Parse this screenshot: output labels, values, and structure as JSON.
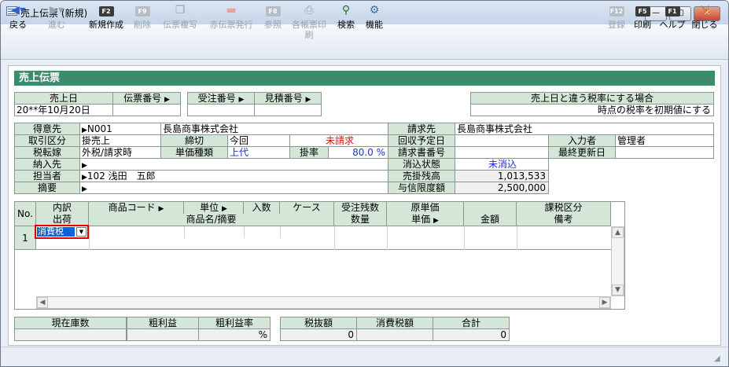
{
  "window": {
    "title": "売上伝票 (新規)",
    "controls": {
      "minimize": "—",
      "maximize": "□",
      "close": "✕"
    }
  },
  "toolbar": {
    "back": "戻る",
    "forward": "進む",
    "new": "新規作成",
    "delete": "削除",
    "copy": "伝票複写",
    "red_slip": "赤伝票発行",
    "reference": "参照",
    "print_multi": "各帳票印刷",
    "search": "検索",
    "function": "機能",
    "register": "登録",
    "print": "印刷",
    "help": "ヘルプ",
    "close": "閉じる",
    "keys": {
      "new": "F2",
      "delete": "F9",
      "reference": "F8",
      "register": "F12",
      "print": "F5",
      "help": "F1"
    }
  },
  "header": {
    "title": "売上伝票"
  },
  "slip": {
    "sales_date_label": "売上日",
    "sales_date": "20**年10月20日",
    "slip_no_label": "伝票番号",
    "order_no_label": "受注番号",
    "estimate_no_label": "見積番号",
    "tax_rate_label": "売上日と違う税率にする場合",
    "tax_rate_button": "時点の税率を初期値にする"
  },
  "customer": {
    "customer_label": "得意先",
    "customer_code": "N001",
    "customer_name": "長島商事株式会社",
    "billing_label": "請求先",
    "billing_name": "長島商事株式会社",
    "trade_label": "取引区分",
    "trade_value": "掛売上",
    "closing_label": "締切",
    "closing_value": "今回",
    "billing_status": "未請求",
    "collection_label": "回収予定日",
    "inputter_label": "入力者",
    "inputter_value": "管理者",
    "tax_label": "税転嫁",
    "tax_value": "外税/請求時",
    "price_type_label": "単価種類",
    "price_type_value": "上代",
    "rate_label": "掛率",
    "rate_value": "80.0 %",
    "invoice_no_label": "請求書番号",
    "last_update_label": "最終更新日",
    "delivery_label": "納入先",
    "clear_label": "消込状態",
    "clear_value": "未消込",
    "staff_label": "担当者",
    "staff_code": "102",
    "staff_name": "浅田　五郎",
    "receivable_label": "売掛残高",
    "receivable_value": "1,013,533",
    "memo_label": "摘要",
    "credit_label": "与信限度額",
    "credit_value": "2,500,000"
  },
  "grid": {
    "headers_top": [
      "No.",
      "内訳",
      "商品コード",
      "単位",
      "入数",
      "ケース",
      "受注残数",
      "原単価",
      "",
      "課税区分"
    ],
    "headers_bottom": [
      "出荷",
      "商品名/摘要",
      "数量",
      "単価",
      "金額",
      "備考"
    ],
    "row_no": "1",
    "row_type": "消費税"
  },
  "totals": {
    "stock_label": "現在庫数",
    "gross_label": "粗利益",
    "gross_rate_label": "粗利益率",
    "gross_rate_value": "%",
    "pretax_label": "税抜額",
    "pretax_value": "0",
    "tax_label": "消費税額",
    "total_label": "合計",
    "total_value": "0"
  }
}
